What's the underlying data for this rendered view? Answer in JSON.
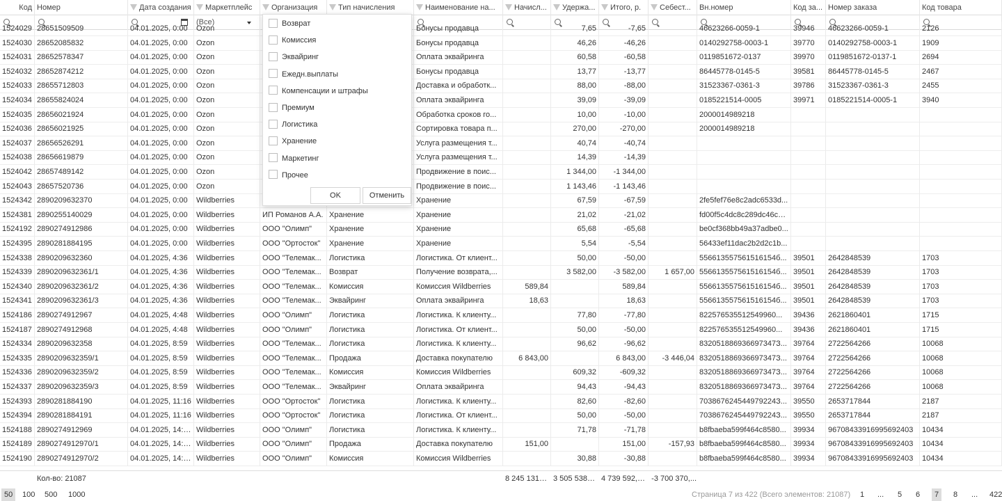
{
  "columns": [
    {
      "key": "kod",
      "label": "Код",
      "filter": false
    },
    {
      "key": "nomer",
      "label": "Номер",
      "filter": false
    },
    {
      "key": "date",
      "label": "Дата создания",
      "filter": true
    },
    {
      "key": "market",
      "label": "Маркетплейс",
      "filter": true
    },
    {
      "key": "org",
      "label": "Организация",
      "filter": true
    },
    {
      "key": "type",
      "label": "Тип начисления",
      "filter": true
    },
    {
      "key": "name",
      "label": "Наименование на...",
      "filter": true
    },
    {
      "key": "nach",
      "label": "Начисл...",
      "filter": true
    },
    {
      "key": "uder",
      "label": "Удержа...",
      "filter": true
    },
    {
      "key": "itog",
      "label": "Итого, р.",
      "filter": true
    },
    {
      "key": "sebest",
      "label": "Себест...",
      "filter": true
    },
    {
      "key": "vn",
      "label": "Вн.номер",
      "filter": false
    },
    {
      "key": "kodzak",
      "label": "Код за...",
      "filter": false
    },
    {
      "key": "nomzak",
      "label": "Номер заказа",
      "filter": false
    },
    {
      "key": "kodtov",
      "label": "Код товара",
      "filter": false
    }
  ],
  "filter_row": {
    "market_value": "(Все)"
  },
  "rows": [
    [
      "1524029",
      "28651509509",
      "04.01.2025, 0:00",
      "Ozon",
      "",
      "",
      "Бонусы продавца",
      "",
      "7,65",
      "-7,65",
      "",
      "46623266-0059-1",
      "39946",
      "46623266-0059-1",
      "2126"
    ],
    [
      "1524030",
      "28652085832",
      "04.01.2025, 0:00",
      "Ozon",
      "",
      "",
      "Бонусы продавца",
      "",
      "46,26",
      "-46,26",
      "",
      "0140292758-0003-1",
      "39770",
      "0140292758-0003-1",
      "1909"
    ],
    [
      "1524031",
      "28652578347",
      "04.01.2025, 0:00",
      "Ozon",
      "",
      "",
      "Оплата эквайринга",
      "",
      "60,58",
      "-60,58",
      "",
      "0119851672-0137",
      "39970",
      "0119851672-0137-1",
      "2694"
    ],
    [
      "1524032",
      "28652874212",
      "04.01.2025, 0:00",
      "Ozon",
      "",
      "",
      "Бонусы продавца",
      "",
      "13,77",
      "-13,77",
      "",
      "86445778-0145-5",
      "39581",
      "86445778-0145-5",
      "2467"
    ],
    [
      "1524033",
      "28655712803",
      "04.01.2025, 0:00",
      "Ozon",
      "",
      "",
      "Доставка и обработк...",
      "",
      "88,00",
      "-88,00",
      "",
      "31523367-0361-3",
      "39786",
      "31523367-0361-3",
      "2455"
    ],
    [
      "1524034",
      "28655824024",
      "04.01.2025, 0:00",
      "Ozon",
      "",
      "",
      "Оплата эквайринга",
      "",
      "39,09",
      "-39,09",
      "",
      "0185221514-0005",
      "39971",
      "0185221514-0005-1",
      "3940"
    ],
    [
      "1524035",
      "28656021924",
      "04.01.2025, 0:00",
      "Ozon",
      "",
      "",
      "Обработка сроков го...",
      "",
      "10,00",
      "-10,00",
      "",
      "2000014989218",
      "",
      "",
      ""
    ],
    [
      "1524036",
      "28656021925",
      "04.01.2025, 0:00",
      "Ozon",
      "",
      "",
      "Сортировка товара п...",
      "",
      "270,00",
      "-270,00",
      "",
      "2000014989218",
      "",
      "",
      ""
    ],
    [
      "1524037",
      "28656526291",
      "04.01.2025, 0:00",
      "Ozon",
      "",
      "",
      "Услуга размещения т...",
      "",
      "40,74",
      "-40,74",
      "",
      "",
      "",
      "",
      ""
    ],
    [
      "1524038",
      "28656619879",
      "04.01.2025, 0:00",
      "Ozon",
      "",
      "",
      "Услуга размещения т...",
      "",
      "14,39",
      "-14,39",
      "",
      "",
      "",
      "",
      ""
    ],
    [
      "1524042",
      "28657489142",
      "04.01.2025, 0:00",
      "Ozon",
      "",
      "",
      "Продвижение в поис...",
      "",
      "1 344,00",
      "-1 344,00",
      "",
      "",
      "",
      "",
      ""
    ],
    [
      "1524043",
      "28657520736",
      "04.01.2025, 0:00",
      "Ozon",
      "",
      "",
      "Продвижение в поис...",
      "",
      "1 143,46",
      "-1 143,46",
      "",
      "",
      "",
      "",
      ""
    ],
    [
      "1524342",
      "2890209632370",
      "04.01.2025, 0:00",
      "Wildberries",
      "",
      "",
      "Хранение",
      "",
      "67,59",
      "-67,59",
      "",
      "2fe5fef76e8c2adc6533d...",
      "",
      "",
      ""
    ],
    [
      "1524381",
      "2890255140029",
      "04.01.2025, 0:00",
      "Wildberries",
      "ИП Романов А.А.",
      "Хранение",
      "Хранение",
      "",
      "21,02",
      "-21,02",
      "",
      "fd00f5c4dc8c289dc46c7...",
      "",
      "",
      ""
    ],
    [
      "1524192",
      "2890274912986",
      "04.01.2025, 0:00",
      "Wildberries",
      "ООО \"Олимп\"",
      "Хранение",
      "Хранение",
      "",
      "65,68",
      "-65,68",
      "",
      "be0cf368bb49a37adbe0...",
      "",
      "",
      ""
    ],
    [
      "1524395",
      "2890281884195",
      "04.01.2025, 0:00",
      "Wildberries",
      "ООО \"Ортосток\"",
      "Хранение",
      "Хранение",
      "",
      "5,54",
      "-5,54",
      "",
      "56433ef11dac2b2d2c1b...",
      "",
      "",
      ""
    ],
    [
      "1524338",
      "2890209632360",
      "04.01.2025, 4:36",
      "Wildberries",
      "ООО \"Телемак...",
      "Логистика",
      "Логистика. От клиент...",
      "",
      "50,00",
      "-50,00",
      "",
      "556613557561516154б...",
      "39501",
      "2642848539",
      "1703"
    ],
    [
      "1524339",
      "2890209632361/1",
      "04.01.2025, 4:36",
      "Wildberries",
      "ООО \"Телемак...",
      "Возврат",
      "Получение возврата,...",
      "",
      "3 582,00",
      "-3 582,00",
      "1 657,00",
      "556613557561516154б...",
      "39501",
      "2642848539",
      "1703"
    ],
    [
      "1524340",
      "2890209632361/2",
      "04.01.2025, 4:36",
      "Wildberries",
      "ООО \"Телемак...",
      "Комиссия",
      "Комиссия Wildberries",
      "589,84",
      "",
      "589,84",
      "",
      "556613557561516154б...",
      "39501",
      "2642848539",
      "1703"
    ],
    [
      "1524341",
      "2890209632361/3",
      "04.01.2025, 4:36",
      "Wildberries",
      "ООО \"Телемак...",
      "Эквайринг",
      "Оплата эквайринга",
      "18,63",
      "",
      "18,63",
      "",
      "556613557561516154б...",
      "39501",
      "2642848539",
      "1703"
    ],
    [
      "1524186",
      "2890274912967",
      "04.01.2025, 4:48",
      "Wildberries",
      "ООО \"Олимп\"",
      "Логистика",
      "Логистика. К клиенту...",
      "",
      "77,80",
      "-77,80",
      "",
      "822576535512549960...",
      "39436",
      "2621860401",
      "1715"
    ],
    [
      "1524187",
      "2890274912968",
      "04.01.2025, 4:48",
      "Wildberries",
      "ООО \"Олимп\"",
      "Логистика",
      "Логистика. От клиент...",
      "",
      "50,00",
      "-50,00",
      "",
      "822576535512549960...",
      "39436",
      "2621860401",
      "1715"
    ],
    [
      "1524334",
      "2890209632358",
      "04.01.2025, 8:59",
      "Wildberries",
      "ООО \"Телемак...",
      "Логистика",
      "Логистика. К клиенту...",
      "",
      "96,62",
      "-96,62",
      "",
      "832051886936697347З...",
      "39764",
      "2722564266",
      "10068"
    ],
    [
      "1524335",
      "2890209632359/1",
      "04.01.2025, 8:59",
      "Wildberries",
      "ООО \"Телемак...",
      "Продажа",
      "Доставка покупателю",
      "6 843,00",
      "",
      "6 843,00",
      "-3 446,04",
      "832051886936697347З...",
      "39764",
      "2722564266",
      "10068"
    ],
    [
      "1524336",
      "2890209632359/2",
      "04.01.2025, 8:59",
      "Wildberries",
      "ООО \"Телемак...",
      "Комиссия",
      "Комиссия Wildberries",
      "",
      "609,32",
      "-609,32",
      "",
      "832051886936697347З...",
      "39764",
      "2722564266",
      "10068"
    ],
    [
      "1524337",
      "2890209632359/3",
      "04.01.2025, 8:59",
      "Wildberries",
      "ООО \"Телемак...",
      "Эквайринг",
      "Оплата эквайринга",
      "",
      "94,43",
      "-94,43",
      "",
      "832051886936697347З...",
      "39764",
      "2722564266",
      "10068"
    ],
    [
      "1524393",
      "2890281884190",
      "04.01.2025, 11:16",
      "Wildberries",
      "ООО \"Ортосток\"",
      "Логистика",
      "Логистика. К клиенту...",
      "",
      "82,60",
      "-82,60",
      "",
      "703867624544979224З...",
      "39550",
      "2653717844",
      "2187"
    ],
    [
      "1524394",
      "2890281884191",
      "04.01.2025, 11:16",
      "Wildberries",
      "ООО \"Ортосток\"",
      "Логистика",
      "Логистика. От клиент...",
      "",
      "50,00",
      "-50,00",
      "",
      "703867624544979224З...",
      "39550",
      "2653717844",
      "2187"
    ],
    [
      "1524188",
      "2890274912969",
      "04.01.2025, 14:32",
      "Wildberries",
      "ООО \"Олимп\"",
      "Логистика",
      "Логистика. К клиенту...",
      "",
      "71,78",
      "-71,78",
      "",
      "b8fbaeba599f464c8580...",
      "39934",
      "96708433916995692403",
      "10434"
    ],
    [
      "1524189",
      "2890274912970/1",
      "04.01.2025, 14:32",
      "Wildberries",
      "ООО \"Олимп\"",
      "Продажа",
      "Доставка покупателю",
      "151,00",
      "",
      "151,00",
      "-157,93",
      "b8fbaeba599f464c8580...",
      "39934",
      "96708433916995692403",
      "10434"
    ],
    [
      "1524190",
      "2890274912970/2",
      "04.01.2025, 14:32",
      "Wildberries",
      "ООО \"Олимп\"",
      "Комиссия",
      "Комиссия Wildberries",
      "",
      "30,88",
      "-30,88",
      "",
      "b8fbaeba599f464c8580...",
      "39934",
      "96708433916995692403",
      "10434"
    ]
  ],
  "popup": {
    "items": [
      "Возврат",
      "Комиссия",
      "Эквайринг",
      "Ежедн.выплаты",
      "Компенсации и штрафы",
      "Премиум",
      "Логистика",
      "Хранение",
      "Маркетинг",
      "Прочее"
    ],
    "ok_label": "OK",
    "cancel_label": "Отменить"
  },
  "footer": {
    "count": "Кол-во: 21087",
    "sum_nach": "8 245 131,49",
    "sum_uder": "3 505 538,74",
    "sum_itog": "4 739 592,75",
    "sum_sebest": "-3 700 370,..."
  },
  "pager": {
    "sizes": [
      "50",
      "100",
      "500",
      "1000"
    ],
    "selected_size": "50",
    "info": "Страница 7 из 422 (Всего элементов: 21087)",
    "pages": [
      "1",
      "...",
      "5",
      "6",
      "7",
      "8",
      "...",
      "422"
    ],
    "current_page": "7"
  }
}
